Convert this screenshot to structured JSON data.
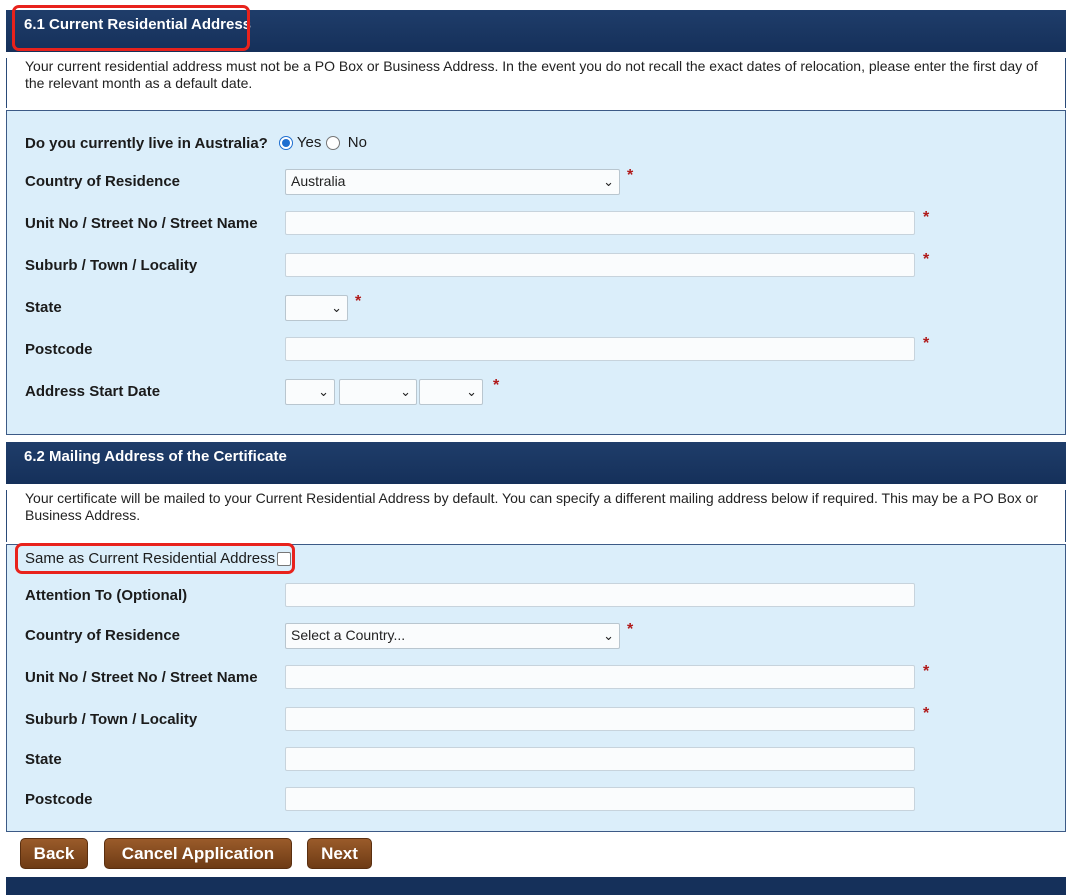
{
  "residential": {
    "heading": "6.1 Current Residential Address",
    "intro": "Your current residential address must not be a PO Box or Business Address. In the event you do not recall the exact dates of relocation, please enter the first day of the relevant month as a default date.",
    "live_in_australia_label": "Do you currently live in Australia?",
    "yes_label": "Yes",
    "no_label": "No",
    "live_in_australia_value": "Yes",
    "country_label": "Country of Residence",
    "country_value": "Australia",
    "street_label": "Unit No / Street No / Street Name",
    "street_value": "",
    "suburb_label": "Suburb / Town / Locality",
    "suburb_value": "",
    "state_label": "State",
    "state_value": "",
    "postcode_label": "Postcode",
    "postcode_value": "",
    "start_date_label": "Address Start Date",
    "start_date_day": "",
    "start_date_month": "",
    "start_date_year": "",
    "required_mark": "*"
  },
  "mailing": {
    "heading": "6.2 Mailing Address of the Certificate",
    "intro": "Your certificate will be mailed to your Current Residential Address by default. You can specify a different mailing address below if required. This may be a PO Box or Business Address.",
    "same_as_label": "Same as Current Residential Address",
    "same_as_checked": false,
    "attention_label": "Attention To (Optional)",
    "attention_value": "",
    "country_label": "Country of Residence",
    "country_value": "Select a Country...",
    "street_label": "Unit No / Street No / Street Name",
    "street_value": "",
    "suburb_label": "Suburb / Town / Locality",
    "suburb_value": "",
    "state_label": "State",
    "state_value": "",
    "postcode_label": "Postcode",
    "postcode_value": "",
    "required_mark": "*"
  },
  "buttons": {
    "back": "Back",
    "cancel": "Cancel Application",
    "next": "Next"
  },
  "colors": {
    "header_bg": "#15305a",
    "form_bg": "#dbeefa",
    "button_bg": "#7a4519",
    "highlight": "#e8221c",
    "required": "#b01a1a"
  }
}
